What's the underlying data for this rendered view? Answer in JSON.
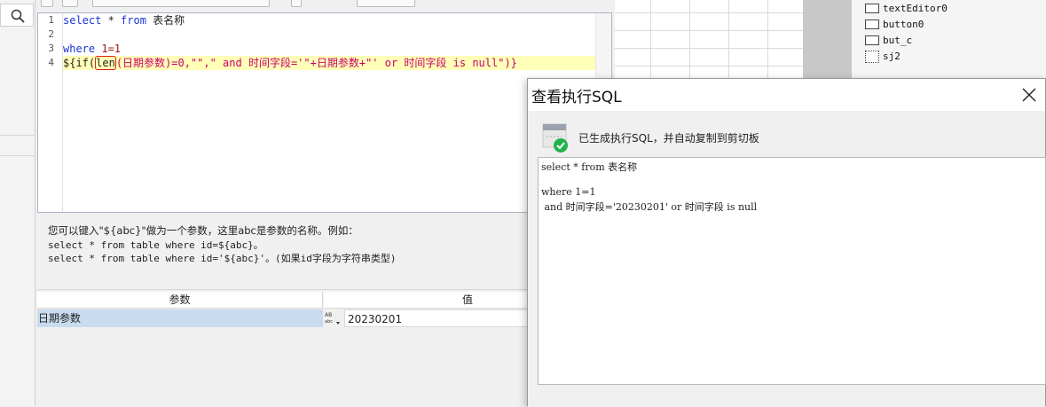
{
  "editor": {
    "line_numbers": [
      "1",
      "2",
      "3",
      "4"
    ],
    "line1": {
      "kw1": "select",
      "mid": " * ",
      "kw2": "from",
      "rest": " 表名称"
    },
    "line3": {
      "kw": "where",
      "rest": " 1=1"
    },
    "line4": {
      "p1": "${if(",
      "p2": "len",
      "p3": "(日期参数)=0,\"\",\" and 时间字段='\"+日期参数+\"' or 时间字段 is null\")}"
    }
  },
  "hint": {
    "line1": "您可以键入\"${abc}\"做为一个参数，这里abc是参数的名称。例如：",
    "line2": "select * from table where id=${abc}。",
    "line3": "select * from table where id='${abc}'。(如果id字段为字符串类型)"
  },
  "param_grid": {
    "headers": [
      "参数",
      "值"
    ],
    "rows": [
      {
        "name": "日期参数",
        "value": "20230201"
      }
    ]
  },
  "component_list": [
    "textEditor0",
    "button0",
    "but_c",
    "sj2"
  ],
  "dialog": {
    "title": "查看执行SQL",
    "message": "已生成执行SQL，并自动复制到剪切板",
    "sql_lines": [
      "select * from 表名称",
      "",
      "where 1=1",
      " and 时间字段='20230201' or 时间字段 is null"
    ]
  },
  "colors": {
    "keyword": "#1c33d6",
    "string_red": "#c8006e",
    "highlight_line": "#ffffb8",
    "selected_row": "#c9dcef",
    "success_green": "#22b34c"
  }
}
